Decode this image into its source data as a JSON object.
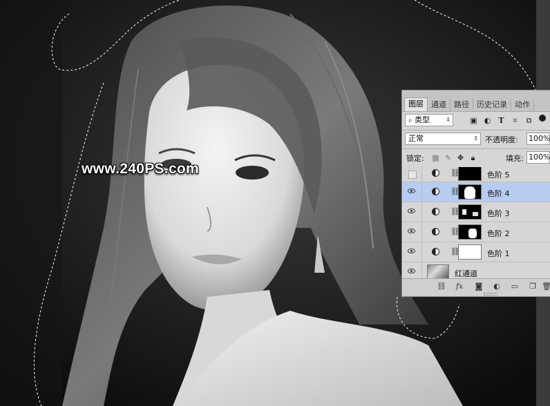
{
  "watermark": "www.240PS.com",
  "panel": {
    "tabs": [
      {
        "label": "图层",
        "active": true
      },
      {
        "label": "通道",
        "active": false
      },
      {
        "label": "路径",
        "active": false
      },
      {
        "label": "历史记录",
        "active": false
      },
      {
        "label": "动作",
        "active": false
      }
    ],
    "filter_label": "类型",
    "blend_mode": "正常",
    "opacity_label": "不透明度:",
    "opacity_value": "100%",
    "lock_label": "锁定:",
    "fill_label": "填充:",
    "fill_value": "100%",
    "layers": [
      {
        "name": "色阶 5",
        "visible": false,
        "selected": false,
        "type": "adjustment"
      },
      {
        "name": "色阶 4",
        "visible": true,
        "selected": true,
        "type": "adjustment"
      },
      {
        "name": "色阶 3",
        "visible": true,
        "selected": false,
        "type": "adjustment"
      },
      {
        "name": "色阶 2",
        "visible": true,
        "selected": false,
        "type": "adjustment"
      },
      {
        "name": "色阶 1",
        "visible": true,
        "selected": false,
        "type": "adjustment"
      },
      {
        "name": "红通道",
        "visible": true,
        "selected": false,
        "type": "pixel"
      }
    ],
    "footer_icons": [
      "link-icon",
      "fx-icon",
      "add-mask-icon",
      "new-adjustment-icon",
      "new-group-icon",
      "new-layer-icon",
      "delete-icon"
    ]
  },
  "colors": {
    "selected_layer": "#b7ccf0",
    "panel_bg": "#d6d6d6"
  }
}
